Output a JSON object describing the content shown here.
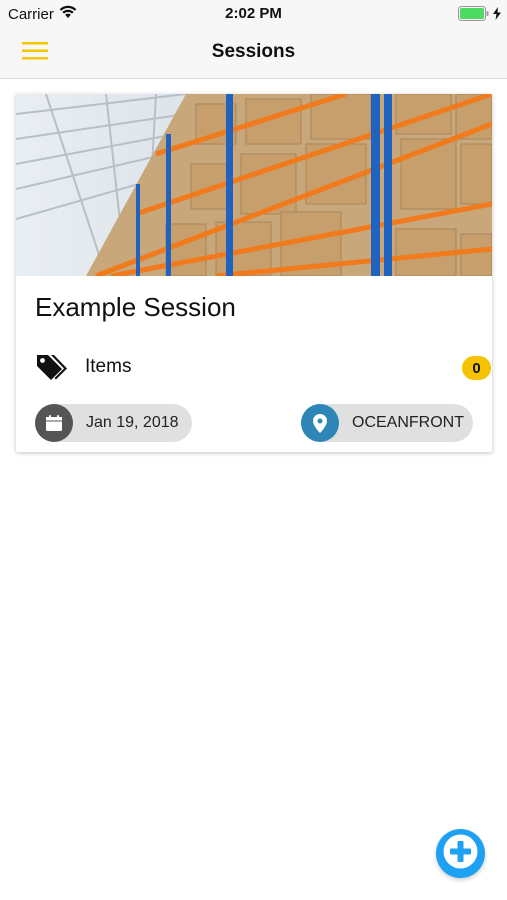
{
  "status_bar": {
    "carrier": "Carrier",
    "time": "2:02 PM",
    "battery_color": "#4cd964"
  },
  "header": {
    "title": "Sessions",
    "menu_icon": "hamburger-icon",
    "menu_icon_color": "#f5c400"
  },
  "session_card": {
    "image_description_icon": "warehouse-shelves-image",
    "title": "Example Session",
    "items_label": "Items",
    "items_icon": "tags-icon",
    "items_count": "0",
    "badge_color": "#f5c400",
    "date": "Jan 19, 2018",
    "date_icon": "calendar-icon",
    "date_icon_bg": "#555555",
    "location": "OCEANFRONT",
    "location_icon": "map-pin-icon",
    "location_icon_bg": "#2e86b7"
  },
  "fab": {
    "icon": "plus-icon",
    "color": "#1ea1f2"
  }
}
